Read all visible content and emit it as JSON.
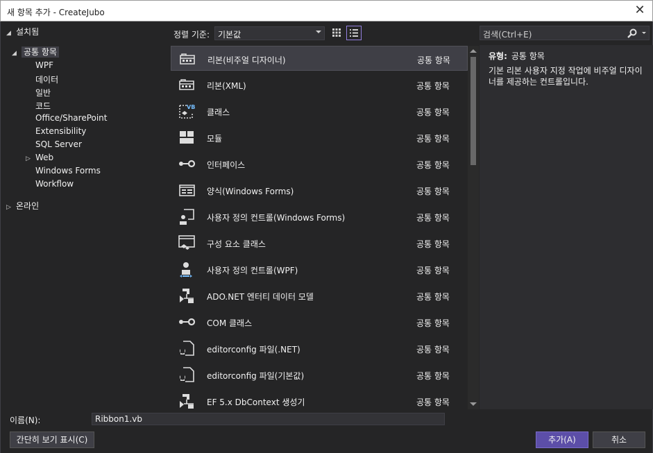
{
  "window": {
    "title": "새 항목 추가 - CreateJubo",
    "close_glyph": "✕"
  },
  "tree": {
    "root1": "설치됨",
    "common": "공통 항목",
    "children": [
      "WPF",
      "데이터",
      "일반",
      "코드",
      "Office/SharePoint",
      "Extensibility",
      "SQL Server",
      "Web",
      "Windows Forms",
      "Workflow"
    ],
    "online": "온라인"
  },
  "sort": {
    "label": "정렬 기준:",
    "value": "기본값"
  },
  "items": [
    {
      "name": "리본(비주얼 디자이너)",
      "category": "공통 항목",
      "icon": "ribbon-icon"
    },
    {
      "name": "리본(XML)",
      "category": "공통 항목",
      "icon": "ribbon-icon"
    },
    {
      "name": "클래스",
      "category": "공통 항목",
      "icon": "vb-class-icon"
    },
    {
      "name": "모듈",
      "category": "공통 항목",
      "icon": "module-icon"
    },
    {
      "name": "인터페이스",
      "category": "공통 항목",
      "icon": "interface-icon"
    },
    {
      "name": "양식(Windows Forms)",
      "category": "공통 항목",
      "icon": "form-icon"
    },
    {
      "name": "사용자 정의 컨트롤(Windows Forms)",
      "category": "공통 항목",
      "icon": "user-control-icon"
    },
    {
      "name": "구성 요소 클래스",
      "category": "공통 항목",
      "icon": "component-class-icon"
    },
    {
      "name": "사용자 정의 컨트롤(WPF)",
      "category": "공통 항목",
      "icon": "wpf-user-control-icon"
    },
    {
      "name": "ADO.NET 엔터티 데이터 모델",
      "category": "공통 항목",
      "icon": "entity-model-icon"
    },
    {
      "name": "COM 클래스",
      "category": "공통 항목",
      "icon": "interface-icon"
    },
    {
      "name": "editorconfig 파일(.NET)",
      "category": "공통 항목",
      "icon": "config-file-icon"
    },
    {
      "name": "editorconfig 파일(기본값)",
      "category": "공통 항목",
      "icon": "config-file-icon"
    },
    {
      "name": "EF 5.x DbContext 생성기",
      "category": "공통 항목",
      "icon": "entity-model-icon"
    }
  ],
  "search": {
    "placeholder": "검색(Ctrl+E)"
  },
  "details": {
    "type_label": "유형:",
    "type_value": "공통 항목",
    "description": "기본 리본 사용자 지정 작업에 비주얼 디자이너를 제공하는 컨트롤입니다."
  },
  "name_field": {
    "label": "이름(N):",
    "value": "Ribbon1.vb"
  },
  "buttons": {
    "compact": "간단히 보기 표시(C)",
    "add": "추가(A)",
    "cancel": "취소"
  },
  "colors": {
    "background": "#252526",
    "accent": "#5c4ea8",
    "text": "#f1f1f1"
  }
}
